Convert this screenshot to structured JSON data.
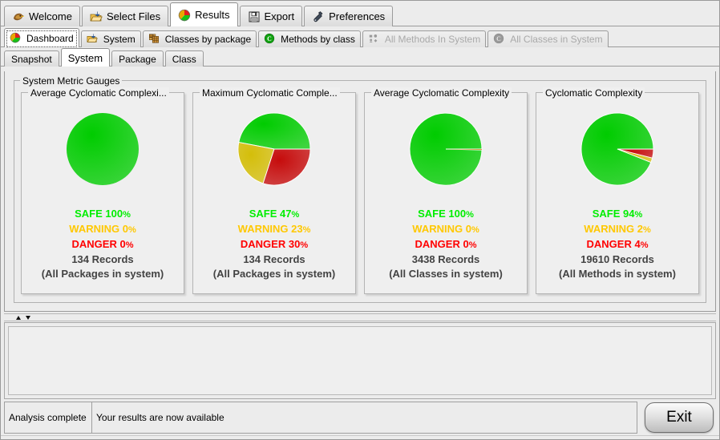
{
  "window": {
    "title": "Results"
  },
  "accent": {
    "safe": "#00EE00",
    "warning": "#FFC800",
    "danger": "#FF0000",
    "record_text": "#434343"
  },
  "primary_tabs": [
    {
      "label": "Welcome",
      "icon": "hawk-head-icon",
      "selected": false,
      "enabled": true
    },
    {
      "label": "Select Files",
      "icon": "open-folder-icon",
      "selected": false,
      "enabled": true
    },
    {
      "label": "Results",
      "icon": "pie-chart-icon",
      "selected": true,
      "enabled": true
    },
    {
      "label": "Export",
      "icon": "floppy-disk-icon",
      "selected": false,
      "enabled": true
    },
    {
      "label": "Preferences",
      "icon": "wrench-icon",
      "selected": false,
      "enabled": true
    }
  ],
  "secondary_tabs": [
    {
      "label": "Dashboard",
      "icon": "pie-chart-icon",
      "selected": true,
      "enabled": true
    },
    {
      "label": "System",
      "icon": "open-folder-icon",
      "selected": false,
      "enabled": true
    },
    {
      "label": "Classes by package",
      "icon": "package-grid-icon",
      "selected": false,
      "enabled": true
    },
    {
      "label": "Methods by class",
      "icon": "class-circle-icon",
      "selected": false,
      "enabled": true
    },
    {
      "label": "All Methods In System",
      "icon": "people-group-icon",
      "selected": false,
      "enabled": false
    },
    {
      "label": "All Classes in System",
      "icon": "class-circle-icon",
      "selected": false,
      "enabled": false
    }
  ],
  "tertiary_tabs": [
    {
      "label": "Snapshot",
      "selected": false
    },
    {
      "label": "System",
      "selected": true
    },
    {
      "label": "Package",
      "selected": false
    },
    {
      "label": "Class",
      "selected": false
    }
  ],
  "panel": {
    "title": "System Metric Gauges"
  },
  "legend_labels": {
    "safe": "SAFE",
    "warning": "WARNING",
    "danger": "DANGER",
    "records_suffix": "Records"
  },
  "gauges": [
    {
      "title": "Average Cyclomatic Complexi...",
      "safe_pct": "100",
      "warning_pct": "0",
      "danger_pct": "0",
      "safe_label": "SAFE 100",
      "warning_label": "WARNING 0",
      "danger_label": "DANGER 0",
      "records": "134 Records",
      "scope": "(All Packages in system)",
      "slices": [
        {
          "name": "SAFE",
          "value": 100,
          "color": "#00CC00"
        }
      ]
    },
    {
      "title": "Maximum Cyclomatic Comple...",
      "safe_pct": "47",
      "warning_pct": "23",
      "danger_pct": "30",
      "safe_label": "SAFE 47",
      "warning_label": "WARNING 23",
      "danger_label": "DANGER 30",
      "records": "134 Records",
      "scope": "(All Packages in system)",
      "slices": [
        {
          "name": "SAFE",
          "value": 47,
          "color": "#00CC00"
        },
        {
          "name": "WARNING",
          "value": 23,
          "color": "#D4BE0A"
        },
        {
          "name": "DANGER",
          "value": 30,
          "color": "#C60C0C"
        }
      ]
    },
    {
      "title": "Average Cyclomatic Complexity",
      "safe_pct": "100",
      "warning_pct": "0",
      "danger_pct": "0",
      "safe_label": "SAFE 100",
      "warning_label": "WARNING 0",
      "danger_label": "DANGER 0",
      "records": "3438 Records",
      "scope": "(All Classes in system)",
      "slices": [
        {
          "name": "SAFE",
          "value": 99.6,
          "color": "#00CC00"
        },
        {
          "name": "WARNING",
          "value": 0.25,
          "color": "#D4BE0A"
        },
        {
          "name": "DANGER",
          "value": 0.15,
          "color": "#C60C0C"
        }
      ]
    },
    {
      "title": "Cyclomatic Complexity",
      "safe_pct": "94",
      "warning_pct": "2",
      "danger_pct": "4",
      "safe_label": "SAFE 94",
      "warning_label": "WARNING 2",
      "danger_label": "DANGER 4",
      "records": "19610 Records",
      "scope": "(All Methods in system)",
      "slices": [
        {
          "name": "SAFE",
          "value": 94,
          "color": "#00CC00"
        },
        {
          "name": "WARNING",
          "value": 2,
          "color": "#D4BE0A"
        },
        {
          "name": "DANGER",
          "value": 4,
          "color": "#C60C0C"
        }
      ]
    }
  ],
  "chart_data": {
    "type": "pie",
    "title": "System Metric Gauges",
    "charts": [
      {
        "title": "Average Cyclomatic Complexi...",
        "labels": [
          "SAFE",
          "WARNING",
          "DANGER"
        ],
        "values": [
          100,
          0,
          0
        ],
        "unit": "%",
        "records": 134,
        "scope": "All Packages in system"
      },
      {
        "title": "Maximum Cyclomatic Comple...",
        "labels": [
          "SAFE",
          "WARNING",
          "DANGER"
        ],
        "values": [
          47,
          23,
          30
        ],
        "unit": "%",
        "records": 134,
        "scope": "All Packages in system"
      },
      {
        "title": "Average Cyclomatic Complexity",
        "labels": [
          "SAFE",
          "WARNING",
          "DANGER"
        ],
        "values": [
          100,
          0,
          0
        ],
        "unit": "%",
        "records": 3438,
        "scope": "All Classes in system"
      },
      {
        "title": "Cyclomatic Complexity",
        "labels": [
          "SAFE",
          "WARNING",
          "DANGER"
        ],
        "values": [
          94,
          2,
          4
        ],
        "unit": "%",
        "records": 19610,
        "scope": "All Methods in system"
      }
    ],
    "colors": {
      "SAFE": "#00CC00",
      "WARNING": "#D4BE0A",
      "DANGER": "#C60C0C"
    },
    "legend_position": "below-chart",
    "grid": false
  },
  "split_divider": {
    "collapse_up": "collapse-up-arrow",
    "collapse_down": "collapse-down-arrow"
  },
  "status": {
    "left": "Analysis complete",
    "right": "Your results are now available"
  },
  "exit": {
    "label": "Exit"
  }
}
